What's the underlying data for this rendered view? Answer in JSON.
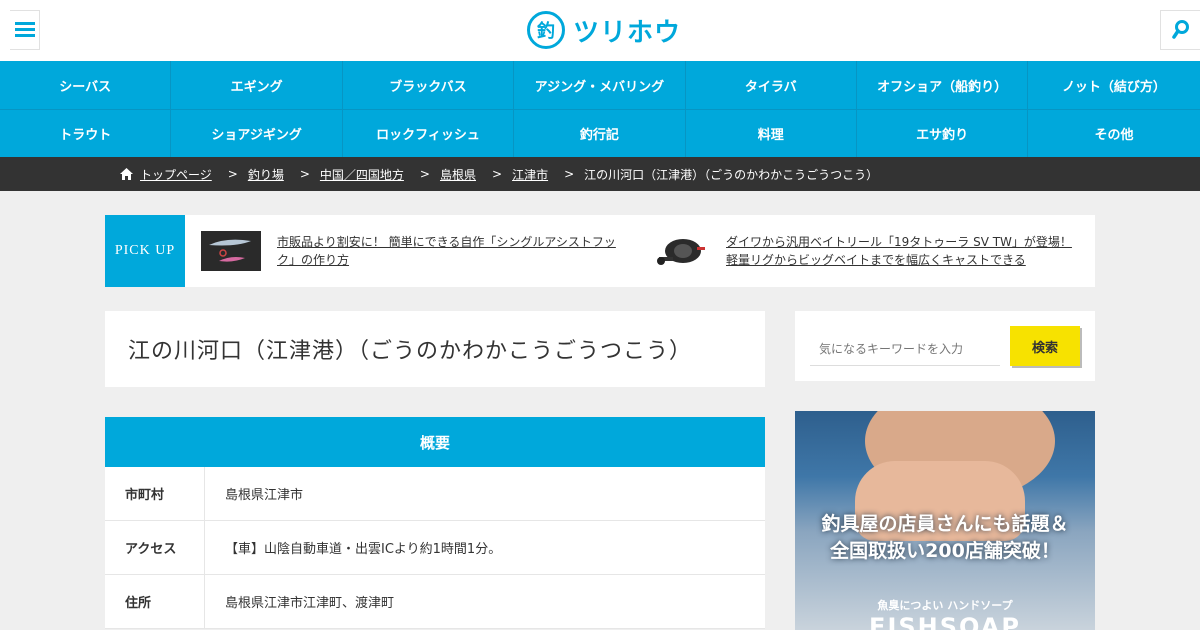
{
  "header": {
    "logo_mark": "釣",
    "logo_text": "ツリホウ"
  },
  "nav": {
    "row1": [
      "シーバス",
      "エギング",
      "ブラックバス",
      "アジング・メバリング",
      "タイラバ",
      "オフショア（船釣り）",
      "ノット（結び方）"
    ],
    "row2": [
      "トラウト",
      "ショアジギング",
      "ロックフィッシュ",
      "釣行記",
      "料理",
      "エサ釣り",
      "その他"
    ]
  },
  "breadcrumb": {
    "items": [
      "トップページ",
      "釣り場",
      "中国／四国地方",
      "島根県",
      "江津市"
    ],
    "current": "江の川河口（江津港）（ごうのかわかこうごうつこう）",
    "separator": ">"
  },
  "pickup": {
    "label": "PICK UP",
    "items": [
      {
        "text": "市販品より割安に！ 簡単にできる自作「シングルアシストフック」の作り方"
      },
      {
        "text": "ダイワから汎用ベイトリール「19タトゥーラ SV TW」が登場！軽量リグからビッグベイトまでを幅広くキャストできる"
      }
    ]
  },
  "page_title": "江の川河口（江津港）（ごうのかわかこうごうつこう）",
  "overview": {
    "heading": "概要",
    "rows": [
      {
        "key": "市町村",
        "value": "島根県江津市"
      },
      {
        "key": "アクセス",
        "value": "【車】山陰自動車道・出雲ICより約1時間1分。"
      },
      {
        "key": "住所",
        "value": "島根県江津市江津町、渡津町"
      }
    ]
  },
  "search": {
    "placeholder": "気になるキーワードを入力",
    "button_label": "検索"
  },
  "ad": {
    "copy_line1": "釣具屋の店員さんにも話題＆",
    "copy_line2": "全国取扱い200店舗突破！",
    "copy_small": "魚臭につよい ハンドソープ",
    "copy_brand": "FISHSOAP"
  },
  "colors": {
    "accent": "#00a8db",
    "breadcrumb_bg": "#333333",
    "search_button": "#f7e200"
  }
}
